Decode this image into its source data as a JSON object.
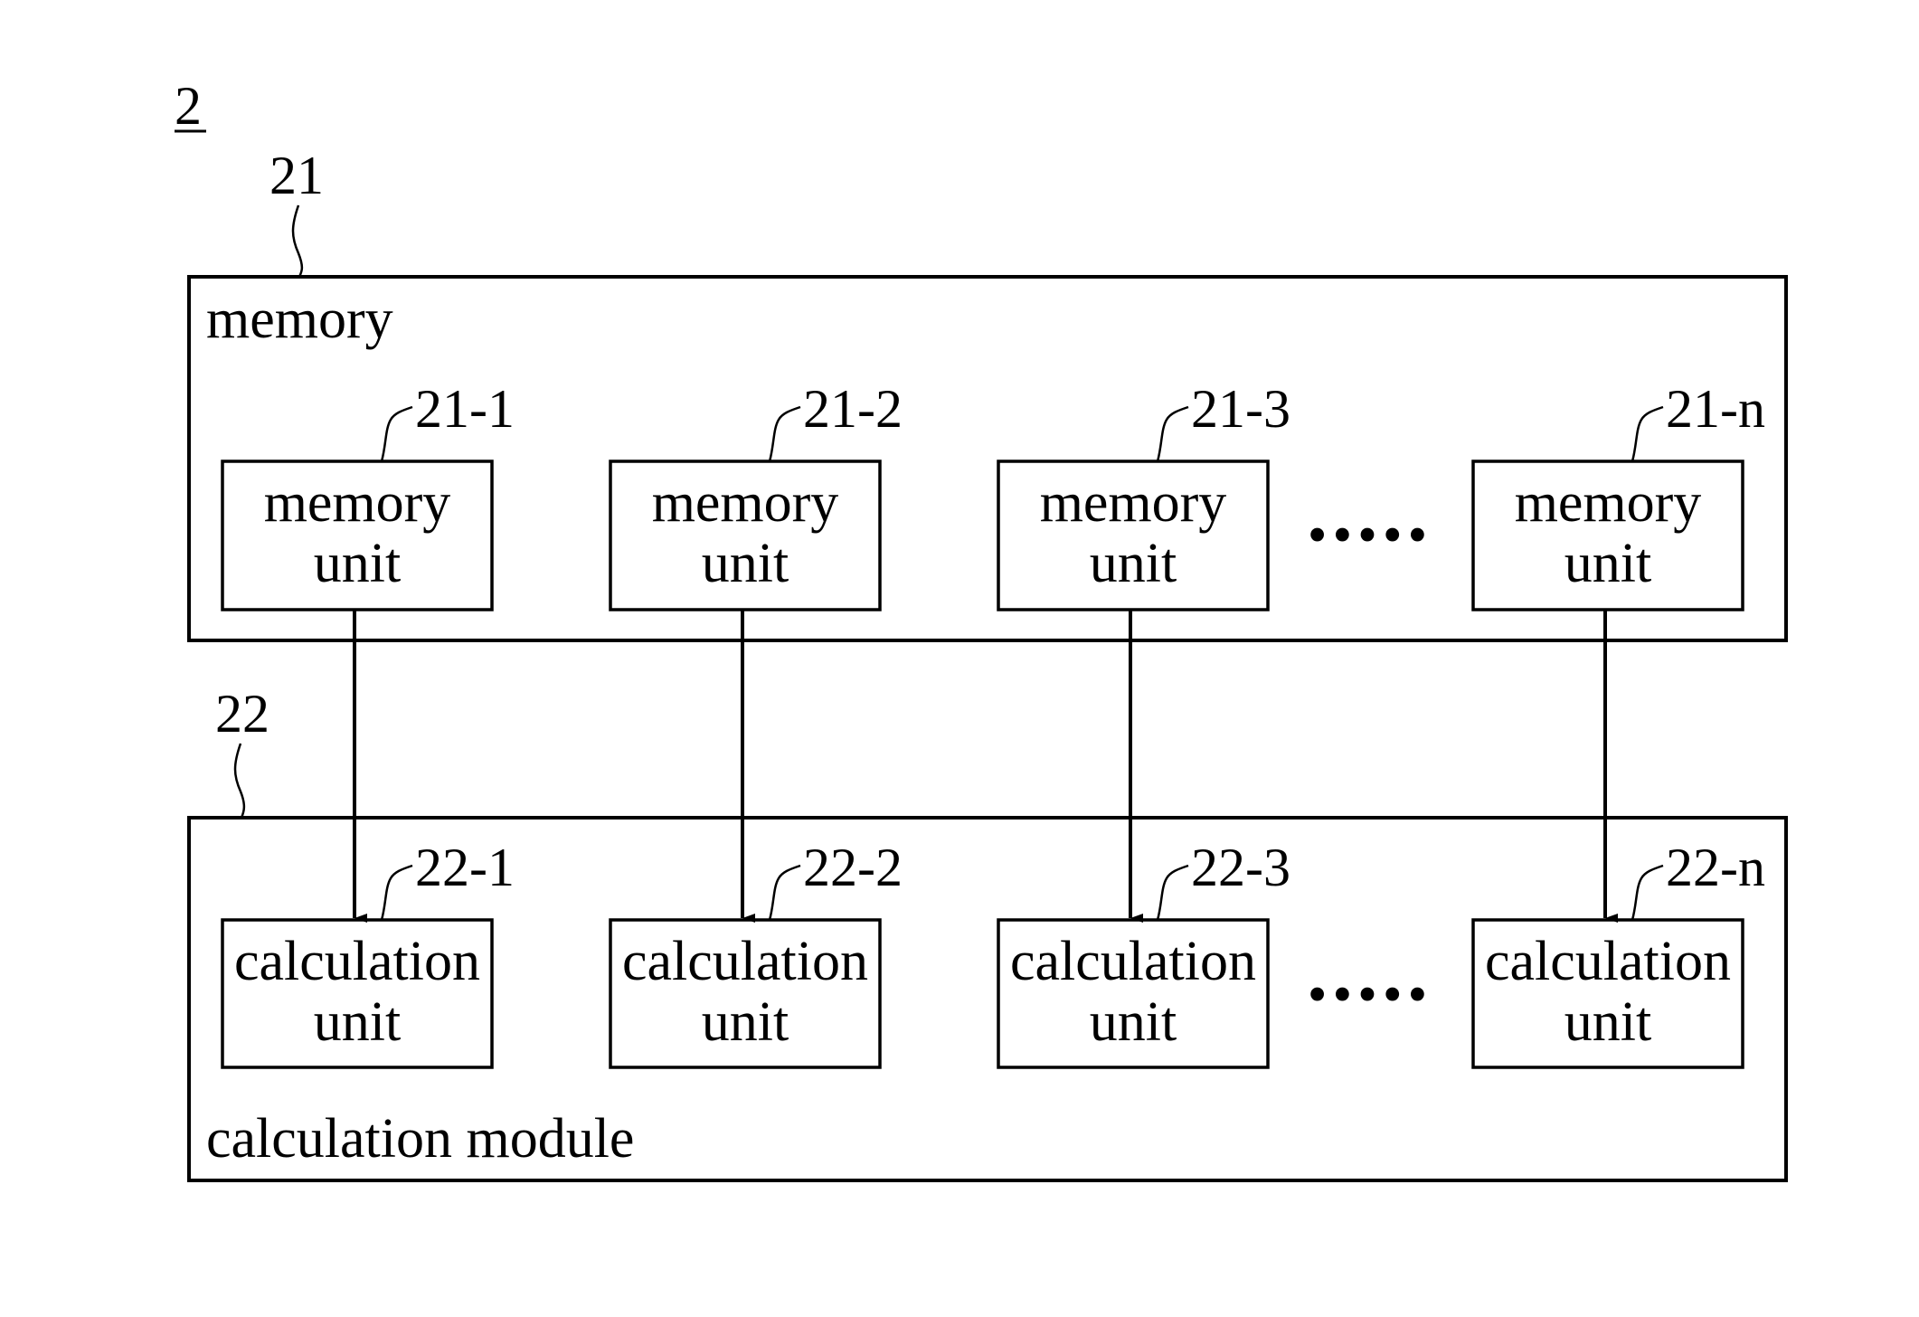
{
  "figure": {
    "number": "2",
    "memory": {
      "ref": "21",
      "label": "memory",
      "units": [
        {
          "ref": "21-1",
          "line1": "memory",
          "line2": "unit"
        },
        {
          "ref": "21-2",
          "line1": "memory",
          "line2": "unit"
        },
        {
          "ref": "21-3",
          "line1": "memory",
          "line2": "unit"
        },
        {
          "ref": "21-n",
          "line1": "memory",
          "line2": "unit"
        }
      ],
      "ellipsis": "•••••"
    },
    "calculation": {
      "ref": "22",
      "label": "calculation module",
      "units": [
        {
          "ref": "22-1",
          "line1": "calculation",
          "line2": "unit"
        },
        {
          "ref": "22-2",
          "line1": "calculation",
          "line2": "unit"
        },
        {
          "ref": "22-3",
          "line1": "calculation",
          "line2": "unit"
        },
        {
          "ref": "22-n",
          "line1": "calculation",
          "line2": "unit"
        }
      ],
      "ellipsis": "•••••"
    }
  }
}
